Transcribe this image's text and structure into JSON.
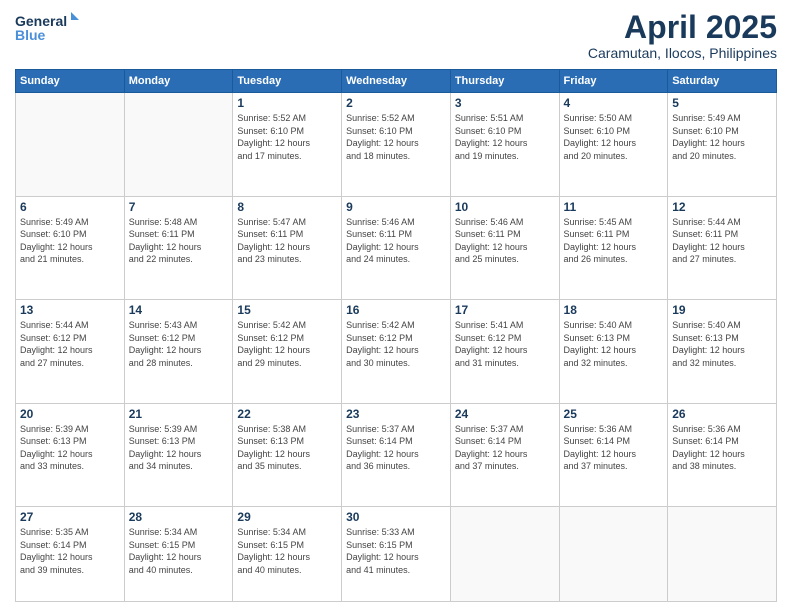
{
  "logo": {
    "line1": "General",
    "line2": "Blue"
  },
  "title": "April 2025",
  "location": "Caramutan, Ilocos, Philippines",
  "days_header": [
    "Sunday",
    "Monday",
    "Tuesday",
    "Wednesday",
    "Thursday",
    "Friday",
    "Saturday"
  ],
  "weeks": [
    [
      {
        "num": "",
        "detail": ""
      },
      {
        "num": "",
        "detail": ""
      },
      {
        "num": "1",
        "detail": "Sunrise: 5:52 AM\nSunset: 6:10 PM\nDaylight: 12 hours\nand 17 minutes."
      },
      {
        "num": "2",
        "detail": "Sunrise: 5:52 AM\nSunset: 6:10 PM\nDaylight: 12 hours\nand 18 minutes."
      },
      {
        "num": "3",
        "detail": "Sunrise: 5:51 AM\nSunset: 6:10 PM\nDaylight: 12 hours\nand 19 minutes."
      },
      {
        "num": "4",
        "detail": "Sunrise: 5:50 AM\nSunset: 6:10 PM\nDaylight: 12 hours\nand 20 minutes."
      },
      {
        "num": "5",
        "detail": "Sunrise: 5:49 AM\nSunset: 6:10 PM\nDaylight: 12 hours\nand 20 minutes."
      }
    ],
    [
      {
        "num": "6",
        "detail": "Sunrise: 5:49 AM\nSunset: 6:10 PM\nDaylight: 12 hours\nand 21 minutes."
      },
      {
        "num": "7",
        "detail": "Sunrise: 5:48 AM\nSunset: 6:11 PM\nDaylight: 12 hours\nand 22 minutes."
      },
      {
        "num": "8",
        "detail": "Sunrise: 5:47 AM\nSunset: 6:11 PM\nDaylight: 12 hours\nand 23 minutes."
      },
      {
        "num": "9",
        "detail": "Sunrise: 5:46 AM\nSunset: 6:11 PM\nDaylight: 12 hours\nand 24 minutes."
      },
      {
        "num": "10",
        "detail": "Sunrise: 5:46 AM\nSunset: 6:11 PM\nDaylight: 12 hours\nand 25 minutes."
      },
      {
        "num": "11",
        "detail": "Sunrise: 5:45 AM\nSunset: 6:11 PM\nDaylight: 12 hours\nand 26 minutes."
      },
      {
        "num": "12",
        "detail": "Sunrise: 5:44 AM\nSunset: 6:11 PM\nDaylight: 12 hours\nand 27 minutes."
      }
    ],
    [
      {
        "num": "13",
        "detail": "Sunrise: 5:44 AM\nSunset: 6:12 PM\nDaylight: 12 hours\nand 27 minutes."
      },
      {
        "num": "14",
        "detail": "Sunrise: 5:43 AM\nSunset: 6:12 PM\nDaylight: 12 hours\nand 28 minutes."
      },
      {
        "num": "15",
        "detail": "Sunrise: 5:42 AM\nSunset: 6:12 PM\nDaylight: 12 hours\nand 29 minutes."
      },
      {
        "num": "16",
        "detail": "Sunrise: 5:42 AM\nSunset: 6:12 PM\nDaylight: 12 hours\nand 30 minutes."
      },
      {
        "num": "17",
        "detail": "Sunrise: 5:41 AM\nSunset: 6:12 PM\nDaylight: 12 hours\nand 31 minutes."
      },
      {
        "num": "18",
        "detail": "Sunrise: 5:40 AM\nSunset: 6:13 PM\nDaylight: 12 hours\nand 32 minutes."
      },
      {
        "num": "19",
        "detail": "Sunrise: 5:40 AM\nSunset: 6:13 PM\nDaylight: 12 hours\nand 32 minutes."
      }
    ],
    [
      {
        "num": "20",
        "detail": "Sunrise: 5:39 AM\nSunset: 6:13 PM\nDaylight: 12 hours\nand 33 minutes."
      },
      {
        "num": "21",
        "detail": "Sunrise: 5:39 AM\nSunset: 6:13 PM\nDaylight: 12 hours\nand 34 minutes."
      },
      {
        "num": "22",
        "detail": "Sunrise: 5:38 AM\nSunset: 6:13 PM\nDaylight: 12 hours\nand 35 minutes."
      },
      {
        "num": "23",
        "detail": "Sunrise: 5:37 AM\nSunset: 6:14 PM\nDaylight: 12 hours\nand 36 minutes."
      },
      {
        "num": "24",
        "detail": "Sunrise: 5:37 AM\nSunset: 6:14 PM\nDaylight: 12 hours\nand 37 minutes."
      },
      {
        "num": "25",
        "detail": "Sunrise: 5:36 AM\nSunset: 6:14 PM\nDaylight: 12 hours\nand 37 minutes."
      },
      {
        "num": "26",
        "detail": "Sunrise: 5:36 AM\nSunset: 6:14 PM\nDaylight: 12 hours\nand 38 minutes."
      }
    ],
    [
      {
        "num": "27",
        "detail": "Sunrise: 5:35 AM\nSunset: 6:14 PM\nDaylight: 12 hours\nand 39 minutes."
      },
      {
        "num": "28",
        "detail": "Sunrise: 5:34 AM\nSunset: 6:15 PM\nDaylight: 12 hours\nand 40 minutes."
      },
      {
        "num": "29",
        "detail": "Sunrise: 5:34 AM\nSunset: 6:15 PM\nDaylight: 12 hours\nand 40 minutes."
      },
      {
        "num": "30",
        "detail": "Sunrise: 5:33 AM\nSunset: 6:15 PM\nDaylight: 12 hours\nand 41 minutes."
      },
      {
        "num": "",
        "detail": ""
      },
      {
        "num": "",
        "detail": ""
      },
      {
        "num": "",
        "detail": ""
      }
    ]
  ]
}
